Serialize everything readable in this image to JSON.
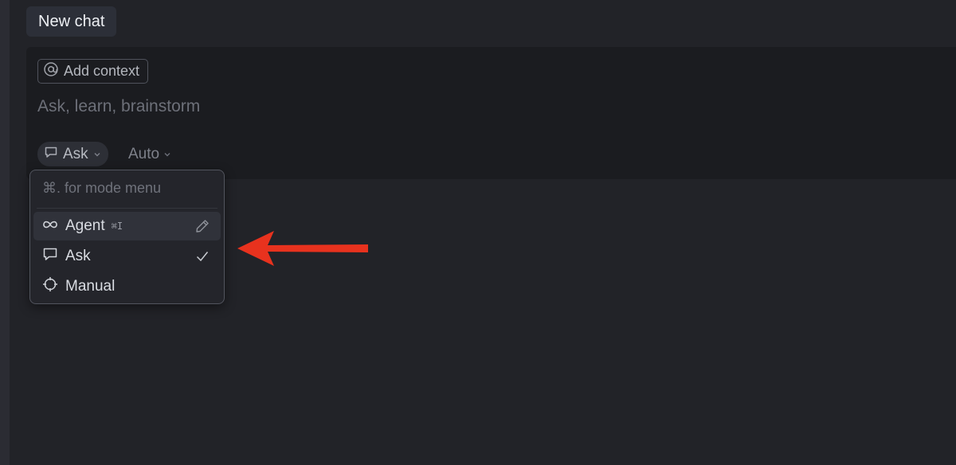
{
  "header": {
    "tab_label": "New chat"
  },
  "composer": {
    "context_chip_label": "Add context",
    "prompt_placeholder": "Ask, learn, brainstorm",
    "mode_label": "Ask",
    "model_label": "Auto"
  },
  "mode_menu": {
    "hint": "⌘. for mode menu",
    "items": [
      {
        "label": "Agent",
        "shortcut": "⌘I",
        "icon": "infinity-icon",
        "trailing_icon": "pencil-icon"
      },
      {
        "label": "Ask",
        "icon": "chat-bubble-icon",
        "trailing_icon": "check-icon"
      },
      {
        "label": "Manual",
        "icon": "crosshair-icon"
      }
    ]
  },
  "colors": {
    "background": "#222328",
    "composer": "#1b1c20",
    "menu_background": "#24252b",
    "annotation_arrow": "#e8321e"
  }
}
